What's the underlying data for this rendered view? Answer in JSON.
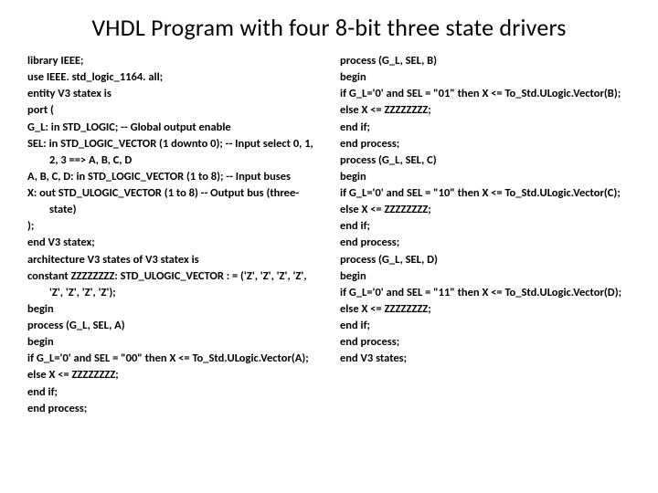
{
  "title": "VHDL Program with four 8-bit three state drivers",
  "left": [
    {
      "t": "library IEEE;",
      "c": false
    },
    {
      "t": "use IEEE. std_logic_1164. all;",
      "c": false
    },
    {
      "t": "entity V3 statex is",
      "c": false
    },
    {
      "t": "port (",
      "c": false
    },
    {
      "t": "G_L: in STD_LOGIC; -- Global output enable",
      "c": false
    },
    {
      "t": "SEL: in STD_LOGIC_VECTOR (1 downto 0); -- Input select 0, 1, 2, 3 ==> A, B, C, D",
      "c": false
    },
    {
      "t": "A, B, C, D: in STD_LOGIC_VECTOR (1 to 8); -- Input buses",
      "c": false
    },
    {
      "t": "X: out STD_ULOGIC_VECTOR (1 to 8) -- Output bus (three-state)",
      "c": false
    },
    {
      "t": ");",
      "c": false
    },
    {
      "t": "end V3 statex;",
      "c": false
    },
    {
      "t": "architecture V3 states of V3 statex is",
      "c": false
    },
    {
      "t": "constant ZZZZZZZZ: STD_ULOGIC_VECTOR : = ('Z', 'Z', 'Z', 'Z', 'Z', 'Z', 'Z', 'Z');",
      "c": false
    },
    {
      "t": "begin",
      "c": false
    },
    {
      "t": "process (G_L, SEL, A)",
      "c": false
    },
    {
      "t": "begin",
      "c": false
    },
    {
      "t": "if G_L='0' and SEL = \"00\" then X <= To_Std.ULogic.Vector(A);",
      "c": false
    },
    {
      "t": "else X <= ZZZZZZZZ;",
      "c": false
    },
    {
      "t": "end if;",
      "c": false
    },
    {
      "t": "end process;",
      "c": false
    }
  ],
  "right": [
    {
      "t": "process (G_L, SEL, B)",
      "c": false
    },
    {
      "t": "begin",
      "c": false
    },
    {
      "t": "if G_L='0' and SEL = \"01\" then X <= To_Std.ULogic.Vector(B);",
      "c": false
    },
    {
      "t": "else X <= ZZZZZZZZ;",
      "c": false
    },
    {
      "t": "end if;",
      "c": false
    },
    {
      "t": "end process;",
      "c": false
    },
    {
      "t": "process (G_L, SEL, C)",
      "c": false
    },
    {
      "t": "begin",
      "c": false
    },
    {
      "t": "if G_L='0' and SEL = \"10\" then X <= To_Std.ULogic.Vector(C);",
      "c": false
    },
    {
      "t": "else X <= ZZZZZZZZ;",
      "c": false
    },
    {
      "t": "end if;",
      "c": false
    },
    {
      "t": "end process;",
      "c": false
    },
    {
      "t": "process (G_L, SEL, D)",
      "c": false
    },
    {
      "t": "begin",
      "c": false
    },
    {
      "t": "if G_L='0' and SEL = \"11\" then X <= To_Std.ULogic.Vector(D);",
      "c": false
    },
    {
      "t": "else X <= ZZZZZZZZ;",
      "c": false
    },
    {
      "t": "end if;",
      "c": false
    },
    {
      "t": "end process;",
      "c": false
    },
    {
      "t": "end V3 states;",
      "c": false
    }
  ]
}
